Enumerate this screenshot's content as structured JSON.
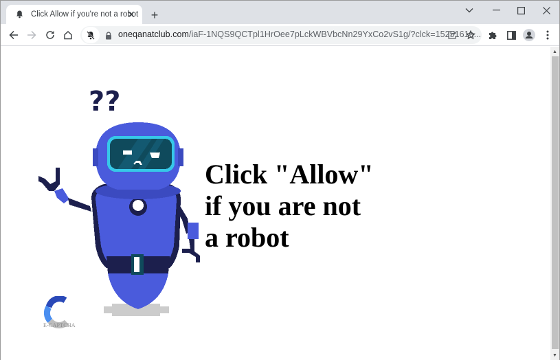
{
  "browser": {
    "tab": {
      "title": "Click Allow if you're not a robot",
      "favicon": "bell-lock-icon",
      "close_label": "✕"
    },
    "new_tab_label": "+",
    "window_controls": {
      "tab_search": "chevron-down-icon",
      "minimize": "minimize-icon",
      "maximize": "maximize-icon",
      "close": "close-icon"
    },
    "toolbar": {
      "back": "back-arrow-icon",
      "forward": "forward-arrow-icon",
      "reload": "reload-icon",
      "home": "home-icon",
      "notifications_blocked": "bell-off-icon",
      "url_host": "oneqanatclub.com",
      "url_path": "/iaF-1NQS9QCTpl1HrOee7pLckWBVbcNn29YxCo2vS1g/?clck=1525161e...",
      "share": "share-icon",
      "bookmark": "star-icon",
      "extensions": "puzzle-icon",
      "side_panel": "side-panel-icon",
      "profile": "profile-icon",
      "menu": "kebab-menu-icon"
    }
  },
  "page": {
    "headline_lines": [
      "Click \"Allow\"",
      "if you are not",
      "a robot"
    ],
    "question_marks": "??",
    "brand_label": "E-CAPTCHA",
    "colors": {
      "robot_body": "#4a5bdc",
      "robot_dark": "#1c1f4d",
      "visor": "#0f4a5c",
      "visor_rim": "#36c8e8",
      "shadow": "#cccccc",
      "captcha_dark_blue": "#2a49b8",
      "captcha_light_blue": "#4a8ef0",
      "captcha_gray": "#bdbdbd"
    }
  },
  "scrollbar": {
    "position": 0
  }
}
